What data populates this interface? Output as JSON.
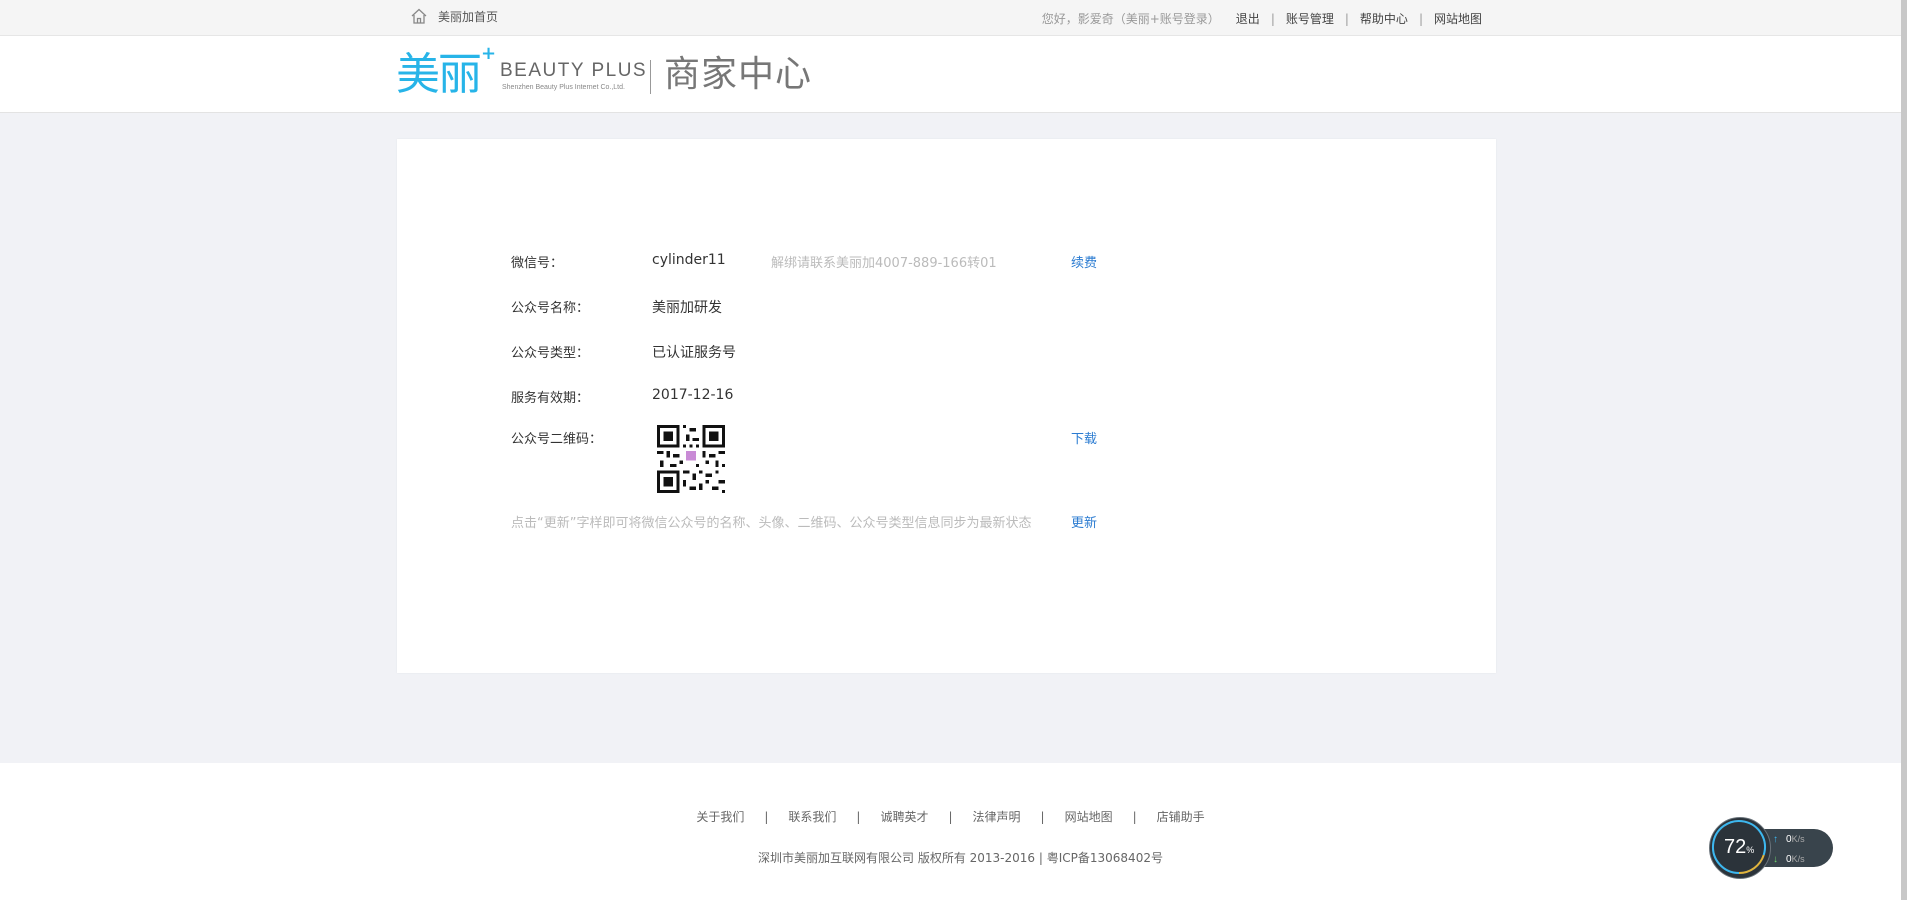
{
  "topbar": {
    "home_label": "美丽加首页",
    "greeting": "您好，影爱奇（美丽+账号登录）",
    "logout": "退出",
    "account": "账号管理",
    "help": "帮助中心",
    "sitemap": "网站地图"
  },
  "header": {
    "logo_cn": "美丽",
    "logo_plus": "+",
    "logo_en": "BEAUTY PLUS",
    "logo_sub": "Shenzhen Beauty Plus Internet Co.,Ltd.",
    "center_title": "商家中心"
  },
  "account_info": {
    "wechat_label": "微信号：",
    "wechat_value": "cylinder11",
    "unbind_note": "解绑请联系美丽加4007-889-166转01",
    "renew_link": "续费",
    "name_label": "公众号名称：",
    "name_value": "美丽加研发",
    "type_label": "公众号类型：",
    "type_value": "已认证服务号",
    "expiry_label": "服务有效期：",
    "expiry_value": "2017-12-16",
    "qr_label": "公众号二维码：",
    "download_link": "下载",
    "hint": "点击“更新”字样即可将微信公众号的名称、头像、二维码、公众号类型信息同步为最新状态",
    "update_link": "更新"
  },
  "footer": {
    "links": [
      "关于我们",
      "联系我们",
      "诚聘英才",
      "法律声明",
      "网站地图",
      "店铺助手"
    ],
    "separator": "|",
    "copyright": "深圳市美丽加互联网有限公司 版权所有 2013-2016 | 粤ICP备13068402号"
  },
  "widget": {
    "percent": "72",
    "percent_unit": "%",
    "up_speed": "0",
    "down_speed": "0",
    "speed_unit": "K/s"
  },
  "colors": {
    "brand": "#27b4e8",
    "link": "#2a7bd1",
    "page_bg": "#f1f2f6"
  }
}
